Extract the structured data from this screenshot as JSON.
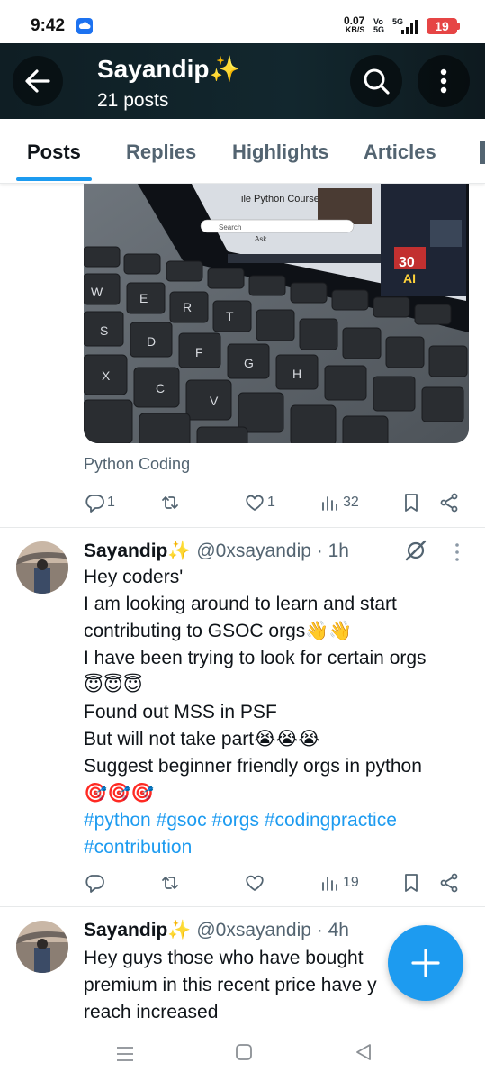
{
  "status_bar": {
    "time": "9:42",
    "net_speed": "0.07",
    "net_unit": "KB/S",
    "volte_top": "Vo",
    "volte_bottom": "5G",
    "network": "5G",
    "battery": "19"
  },
  "header": {
    "title": "Sayandip✨",
    "subtitle": "21 posts"
  },
  "tabs": [
    {
      "label": "Posts",
      "active": true
    },
    {
      "label": "Replies"
    },
    {
      "label": "Highlights"
    },
    {
      "label": "Articles"
    }
  ],
  "post_1": {
    "image_text": {
      "course": "ile Python Course",
      "search": "Search",
      "ask": "Ask",
      "thirty": "30",
      "ai": "AI"
    },
    "source": "Python Coding",
    "actions": {
      "replies": "1",
      "likes": "1",
      "views": "32"
    }
  },
  "post_2": {
    "name": "Sayandip✨",
    "handle": "@0xsayandip · 1h",
    "lines": [
      "Hey coders'",
      "I am looking around to learn and start",
      "contributing to GSOC orgs👋👋",
      "I have been trying to look for certain orgs",
      "😇😇😇",
      "Found out MSS in PSF",
      "But will not take part😭😭😭",
      "Suggest beginner friendly orgs in python",
      "🎯🎯🎯"
    ],
    "hashtags_line1": "#python #gsoc #orgs #codingpractice",
    "hashtags_line2": "#contribution",
    "actions": {
      "views": "19"
    }
  },
  "post_3": {
    "name": "Sayandip✨",
    "handle": "@0xsayandip · 4h",
    "lines": [
      "Hey guys those who have bought",
      "premium in this recent price have y",
      "reach increased"
    ]
  },
  "colors": {
    "accent": "#1d9bf0",
    "text": "#0f1419",
    "muted": "#536471"
  }
}
